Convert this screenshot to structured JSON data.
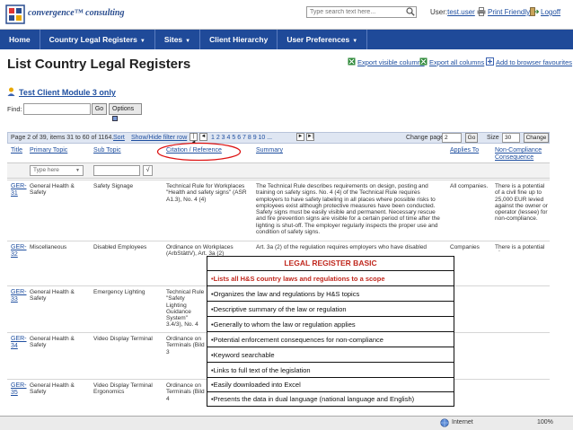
{
  "header": {
    "logo_text": "convergence™ consulting",
    "search_placeholder": "Type search text here...",
    "user_label": "User:",
    "user_name": "test.user",
    "print_label": "Print Friendly",
    "logoff_label": "Logoff"
  },
  "nav": {
    "items": [
      {
        "label": "Home"
      },
      {
        "label": "Country Legal Registers",
        "caret": "▼"
      },
      {
        "label": "Sites",
        "caret": "▼"
      },
      {
        "label": "Client Hierarchy"
      },
      {
        "label": "User Preferences",
        "caret": "▼"
      }
    ]
  },
  "page": {
    "title": "List Country Legal Registers",
    "exports": [
      {
        "label": "Export visible columns"
      },
      {
        "label": "Export all columns"
      },
      {
        "label": "Add to browser favourites"
      }
    ],
    "module_link": "Test Client Module 3 only",
    "find_label": "Find:",
    "go_label": "Go",
    "options_label": "Options"
  },
  "pager": {
    "info": "Page 2 of 39, items 31 to 60 of 1164.",
    "sort_label": "Sort",
    "filter_label": "Show/Hide filter row",
    "first": "|◄",
    "prev": "◄",
    "pages": "1  2  3  4  5  6  7  8  9  10 ...",
    "next": "►",
    "last": "►|",
    "change_page_label": "Change page:",
    "change_page_value": "2",
    "go_label": "Go",
    "size_label": "Size",
    "size_value": "30",
    "change_label": "Change"
  },
  "table": {
    "headers": {
      "title": "Title",
      "primary_topic": "Primary Topic",
      "sub_topic": "Sub Topic",
      "citation": "Citation / Reference",
      "summary": "Summary",
      "applies_to": "Applies To",
      "consequence": "Non-Compliance Consequence"
    },
    "filter_placeholder": "Type here",
    "filter_check": "√",
    "rows": [
      {
        "id": "GER-31",
        "primary": "General Health & Safety",
        "sub": "Safety Signage",
        "citation": "Technical Rule for Workplaces \"Health and safety signs\" (ASR A1.3), No. 4 (4)",
        "summary": "The Technical Rule describes requirements on design, posting and training on safety signs. No. 4 (4) of the Technical Rule requires employers to have safety labeling in all places where possible risks to employees exist although protective measures have been conducted. Safety signs must be easily visible and permanent. Necessary rescue and fire prevention signs are visible for a certain period of time after the lighting is shut-off. The employer regularly inspects the proper use and condition of safety signs.",
        "applies": "All companies.",
        "consequence": "There is a potential of a civil fine up to 25,000 EUR levied against the owner or operator (lessee) for non-compliance."
      },
      {
        "id": "GER-32",
        "primary": "Miscellaneous",
        "sub": "Disabled Employees",
        "citation": "Ordinance on Workplaces (ArbStättV), Art. 3a (2)",
        "summary": "Art. 3a (2) of the regulation requires employers who have disabled",
        "applies": "Companies",
        "consequence": "There is a potential of a"
      },
      {
        "id": "GER-33",
        "primary": "General Health & Safety",
        "sub": "Emergency Lighting",
        "citation": "Technical Rule \"Safety Lighting Guidance System\" 3.4/3), No. 4",
        "summary": "",
        "applies": "",
        "consequence": ""
      },
      {
        "id": "GER-34",
        "primary": "General Health & Safety",
        "sub": "Video Display Terminal",
        "citation": "Ordinance on Terminals (Bild 3",
        "summary": "",
        "applies": "",
        "consequence": ""
      },
      {
        "id": "GER-35",
        "primary": "General Health & Safety",
        "sub": "Video Display Terminal Ergonomics",
        "citation": "Ordinance on Terminals (Bild 4",
        "summary": "",
        "applies": "",
        "consequence": ""
      }
    ]
  },
  "overlay": {
    "title": "LEGAL REGISTER BASIC",
    "items": [
      "•Lists all H&S country laws and regulations to a scope",
      "•Organizes the law and regulations by H&S topics",
      "•Descriptive summary of the law or regulation",
      "•Generally to whom the law or regulation applies",
      "•Potential enforcement consequences for non-compliance",
      "•Keyword searchable",
      "•Links to full text of the legislation",
      "•Easily downloaded into Excel",
      "•Presents the data in dual language (national language and English)"
    ]
  },
  "status": {
    "zone": "Internet",
    "zoom": "100%"
  },
  "colors": {
    "nav_bg": "#1f4a99",
    "link": "#1f4fa0",
    "accent_red": "#c0281e"
  }
}
